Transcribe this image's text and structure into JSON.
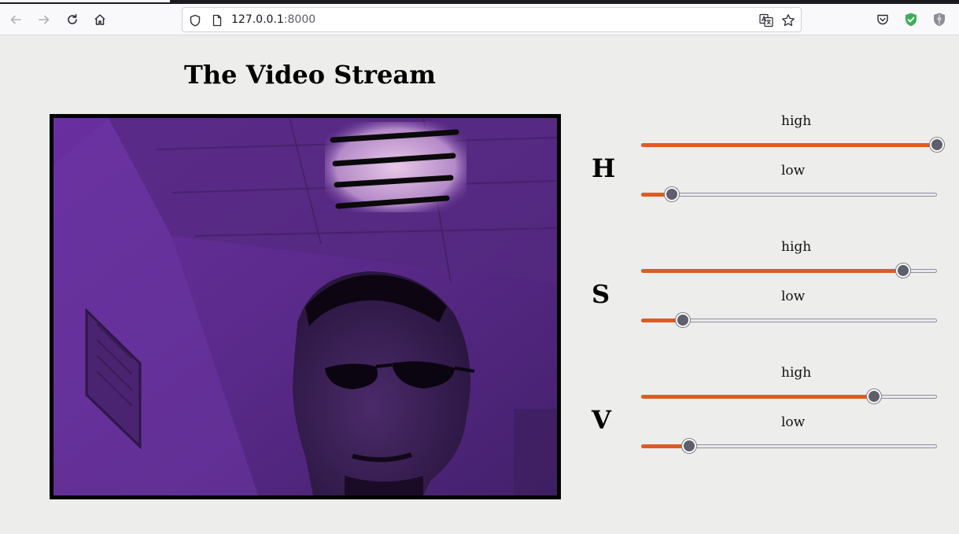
{
  "browser": {
    "url_host": "127.0.0.1",
    "url_port": ":8000"
  },
  "page": {
    "title": "The Video Stream"
  },
  "channels": [
    {
      "label": "H",
      "high": {
        "label": "high",
        "value": 1.0
      },
      "low": {
        "label": "low",
        "value": 0.105
      }
    },
    {
      "label": "S",
      "high": {
        "label": "high",
        "value": 0.885
      },
      "low": {
        "label": "low",
        "value": 0.142
      }
    },
    {
      "label": "V",
      "high": {
        "label": "high",
        "value": 0.787
      },
      "low": {
        "label": "low",
        "value": 0.162
      }
    }
  ],
  "colors": {
    "slider_fill": "#e05a22",
    "slider_thumb": "#5f5f6b",
    "video_tint": "#5a2c86"
  }
}
